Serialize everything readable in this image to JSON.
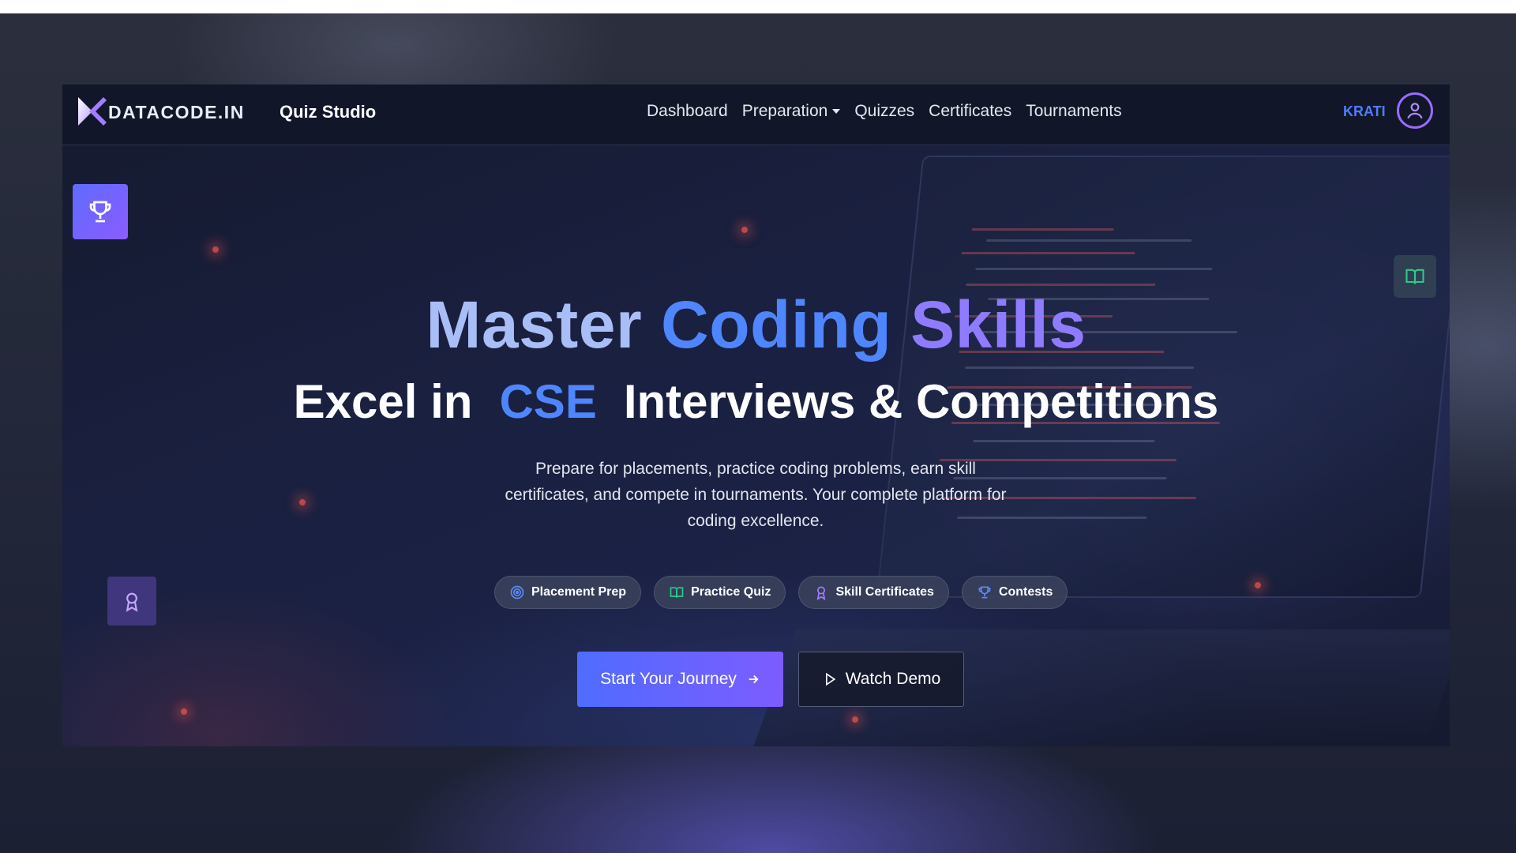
{
  "brand": {
    "logo_text": "DATACODE.IN",
    "product": "Quiz Studio"
  },
  "nav": {
    "items": [
      {
        "label": "Dashboard"
      },
      {
        "label": "Preparation",
        "has_dropdown": true
      },
      {
        "label": "Quizzes"
      },
      {
        "label": "Certificates"
      },
      {
        "label": "Tournaments"
      }
    ],
    "user_name": "KRATI",
    "user_icon": "user-circle-icon"
  },
  "hero": {
    "title_word1": "Master",
    "title_word2": "Coding",
    "title_word3": "Skills",
    "subtitle_prefix": "Excel in",
    "subtitle_highlight": "CSE",
    "subtitle_suffix": "Interviews & Competitions",
    "description": "Prepare for placements, practice coding problems, earn skill certificates, and compete in tournaments. Your complete platform for coding excellence."
  },
  "chips": [
    {
      "label": "Placement Prep",
      "icon": "target-icon",
      "color": "#5b8cff"
    },
    {
      "label": "Practice Quiz",
      "icon": "book-open-icon",
      "color": "#2fc98a"
    },
    {
      "label": "Skill Certificates",
      "icon": "award-icon",
      "color": "#a77bff"
    },
    {
      "label": "Contests",
      "icon": "trophy-icon",
      "color": "#5b8cff"
    }
  ],
  "cta": {
    "primary_label": "Start Your Journey",
    "primary_icon": "arrow-right-icon",
    "secondary_label": "Watch Demo",
    "secondary_icon": "play-icon"
  },
  "floating_icons": {
    "left_top": "trophy-icon",
    "right": "book-open-icon",
    "left_bottom": "award-icon"
  },
  "colors": {
    "accent_blue": "#4f86ff",
    "accent_purple": "#8f7bff",
    "nav_bg": "#111628"
  }
}
